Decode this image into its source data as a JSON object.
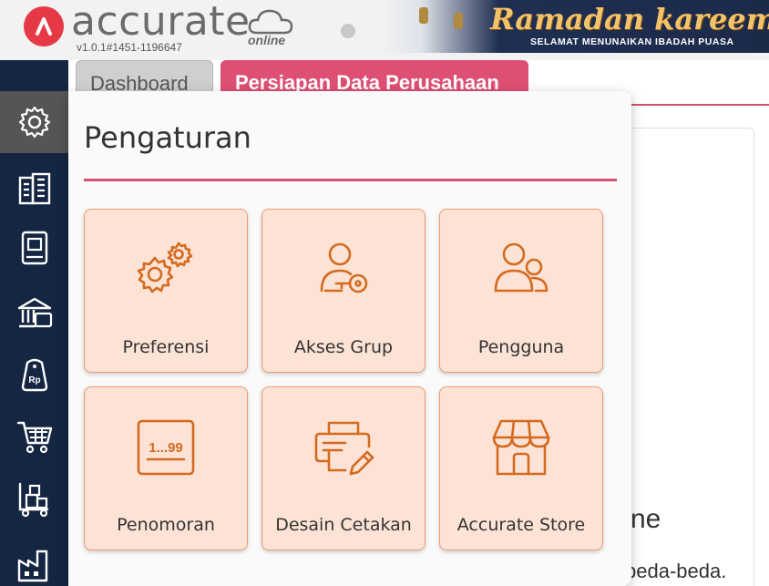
{
  "header": {
    "brand": "accurate",
    "brand_suffix": "online",
    "version": "v1.0.1#1451-1196647",
    "banner_title": "Ramadan kareem",
    "banner_subtitle": "SELAMAT MENUNAIKAN IBADAH PUASA"
  },
  "sidebar": {
    "items": [
      {
        "icon": "gear-icon",
        "active": true
      },
      {
        "icon": "building-icon"
      },
      {
        "icon": "book-icon"
      },
      {
        "icon": "bank-icon"
      },
      {
        "icon": "price-tag-icon",
        "text": "Rp"
      },
      {
        "icon": "cart-icon"
      },
      {
        "icon": "inventory-icon"
      },
      {
        "icon": "factory-icon"
      }
    ]
  },
  "tabs": [
    {
      "label": "Dashboard"
    },
    {
      "label": "Persiapan Data Perusahaan",
      "active": true
    }
  ],
  "background": {
    "partial_text_1": "ne",
    "partial_text_2": "beda-beda."
  },
  "panel": {
    "title": "Pengaturan",
    "tiles": [
      {
        "label": "Preferensi",
        "icon": "gears-icon"
      },
      {
        "label": "Akses Grup",
        "icon": "user-key-icon"
      },
      {
        "label": "Pengguna",
        "icon": "users-icon"
      },
      {
        "label": "Penomoran",
        "icon": "numbering-icon",
        "icon_text": "1...99"
      },
      {
        "label": "Desain Cetakan",
        "icon": "printer-design-icon"
      },
      {
        "label": "Accurate Store",
        "icon": "store-icon"
      }
    ]
  },
  "colors": {
    "accent": "#de4f74",
    "sidebar": "#152642",
    "tile_bg": "#fde3d6",
    "icon": "#d46a1e"
  }
}
